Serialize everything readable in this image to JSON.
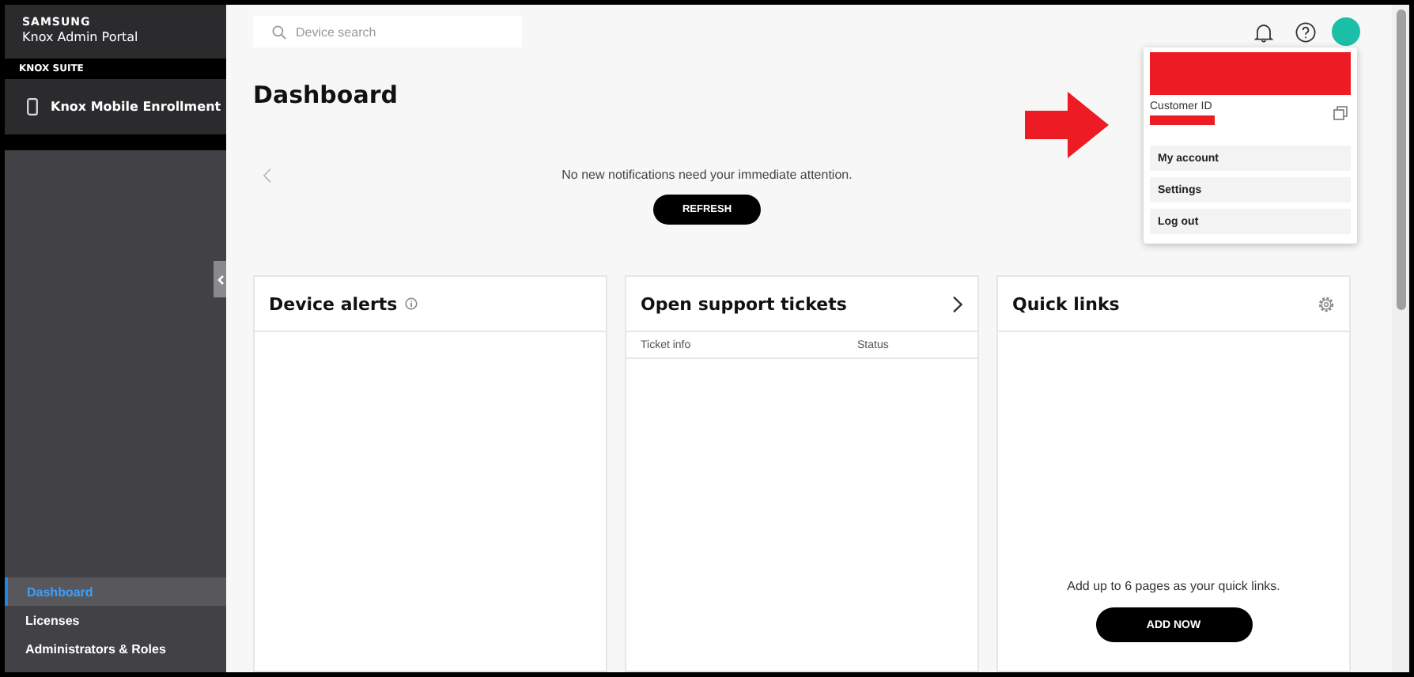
{
  "sidebar": {
    "brand": "SAMSUNG",
    "product": "Knox Admin Portal",
    "section": "KNOX SUITE",
    "app": "Knox Mobile Enrollment",
    "nav": [
      {
        "label": "Dashboard",
        "selected": true
      },
      {
        "label": "Licenses",
        "selected": false
      },
      {
        "label": "Administrators & Roles",
        "selected": false
      }
    ]
  },
  "topbar": {
    "search": {
      "placeholder": "Device search"
    }
  },
  "page": {
    "title": "Dashboard",
    "notice": "No new notifications need your immediate attention.",
    "refresh": "REFRESH"
  },
  "cards": [
    {
      "kind": "alerts",
      "title": "Device alerts"
    },
    {
      "kind": "tickets",
      "title": "Open support tickets",
      "columns": [
        "Ticket info",
        "Status"
      ]
    },
    {
      "kind": "links",
      "title": "Quick links",
      "empty": "Add up to 6 pages as your quick links.",
      "action": "ADD NOW"
    }
  ],
  "account_menu": {
    "id_label": "Customer ID",
    "items": [
      {
        "label": "My account"
      },
      {
        "label": "Settings"
      },
      {
        "label": "Log out"
      }
    ]
  }
}
